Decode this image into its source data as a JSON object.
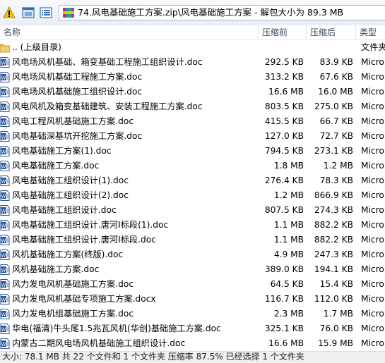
{
  "address": {
    "path": "74.风电基础施工方案.zip\\风电基础施工方案 - 解包大小为 89.3 MB"
  },
  "toolbar": {
    "icons": [
      "warning-icon",
      "window-icon",
      "list-view-icon",
      "archive-icon"
    ]
  },
  "columns": {
    "name": "名称",
    "original": "压缩前",
    "compressed": "压缩后",
    "type": "类型"
  },
  "parent": {
    "label": ".. (上级目录)",
    "type": "文件夹"
  },
  "files": [
    {
      "name": "风电场风机基础、箱变基础工程施工组织设计.doc",
      "original": "292.5 KB",
      "compressed": "83.9 KB",
      "type": "Micro"
    },
    {
      "name": "风电场风机基础工程施工方案.doc",
      "original": "313.2 KB",
      "compressed": "67.6 KB",
      "type": "Micro"
    },
    {
      "name": "风电场风机基础施工组织设计.doc",
      "original": "16.6 MB",
      "compressed": "16.0 MB",
      "type": "Micro"
    },
    {
      "name": "风电风机及箱变基础建筑、安装工程施工方案.doc",
      "original": "803.5 KB",
      "compressed": "275.0 KB",
      "type": "Micro"
    },
    {
      "name": "风电工程风机基础施工方案.doc",
      "original": "415.5 KB",
      "compressed": "66.7 KB",
      "type": "Micro"
    },
    {
      "name": "风电基础深基坑开挖施工方案.doc",
      "original": "127.0 KB",
      "compressed": "72.7 KB",
      "type": "Micro"
    },
    {
      "name": "风电基础施工方案(1).doc",
      "original": "794.5 KB",
      "compressed": "273.1 KB",
      "type": "Micro"
    },
    {
      "name": "风电基础施工方案.doc",
      "original": "1.8 MB",
      "compressed": "1.2 MB",
      "type": "Micro"
    },
    {
      "name": "风电基础施工组织设计(1).doc",
      "original": "276.4 KB",
      "compressed": "78.3 KB",
      "type": "Micro"
    },
    {
      "name": "风电基础施工组织设计(2).doc",
      "original": "1.2 MB",
      "compressed": "866.9 KB",
      "type": "Micro"
    },
    {
      "name": "风电基础施工组织设计.doc",
      "original": "807.5 KB",
      "compressed": "274.3 KB",
      "type": "Micro"
    },
    {
      "name": "风电基础施工组织设计.唐河Ⅰ标段(1).doc",
      "original": "1.1 MB",
      "compressed": "882.2 KB",
      "type": "Micro"
    },
    {
      "name": "风电基础施工组织设计.唐河Ⅰ标段.doc",
      "original": "1.1 MB",
      "compressed": "882.2 KB",
      "type": "Micro"
    },
    {
      "name": "风机基础施工方案(终版).doc",
      "original": "4.9 MB",
      "compressed": "247.3 KB",
      "type": "Micro"
    },
    {
      "name": "风机基础施工方案.doc",
      "original": "389.0 KB",
      "compressed": "194.1 KB",
      "type": "Micro"
    },
    {
      "name": "风力发电风机基础施工方案.doc",
      "original": "64.5 KB",
      "compressed": "15.4 KB",
      "type": "Micro"
    },
    {
      "name": "风力发电风机基础专项施工方案.docx",
      "original": "116.7 KB",
      "compressed": "112.0 KB",
      "type": "Micro"
    },
    {
      "name": "风力发电机组基础施工方案.doc",
      "original": "2.3 MB",
      "compressed": "1.7 MB",
      "type": "Micro"
    },
    {
      "name": "华电(福清)牛头尾1.5兆瓦风机(华创)基础施工方案.doc",
      "original": "325.1 KB",
      "compressed": "76.0 KB",
      "type": "Micro"
    },
    {
      "name": "内蒙古二期风电场风机基础施工组织设计.doc",
      "original": "16.6 MB",
      "compressed": "15.9 MB",
      "type": "Micro"
    }
  ],
  "status": {
    "text": "大小: 78.1 MB 共 22 个文件和 1 个文件夹 压缩率 87.5% 已经选择 1 个文件夹"
  }
}
